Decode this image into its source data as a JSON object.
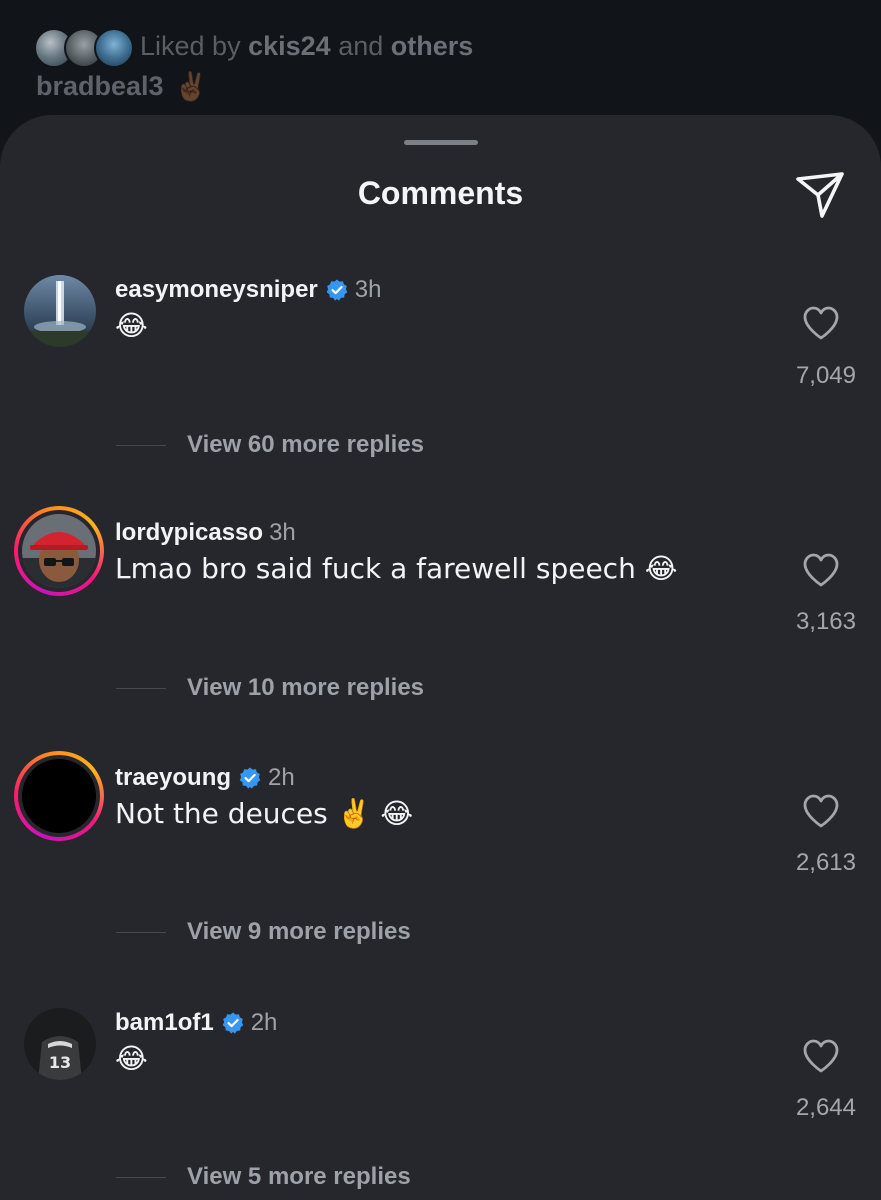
{
  "post": {
    "liked_prefix": "Liked by",
    "liked_user": "ckis24",
    "liked_and": "and",
    "liked_others": "others",
    "caption_user": "bradbeal3",
    "caption_emoji": "✌🏾"
  },
  "sheet": {
    "title": "Comments",
    "share_icon": "send-icon"
  },
  "comments": [
    {
      "username": "easymoneysniper",
      "verified": true,
      "time": "3h",
      "text": "😂",
      "likes": "7,049",
      "replies": "View 60 more replies"
    },
    {
      "username": "lordypicasso",
      "verified": false,
      "time": "3h",
      "text": "Lmao bro said fuck a farewell speech 😂",
      "likes": "3,163",
      "replies": "View 10 more replies"
    },
    {
      "username": "traeyoung",
      "verified": true,
      "time": "2h",
      "text": "Not the deuces ✌️  😂",
      "likes": "2,613",
      "replies": "View 9 more replies"
    },
    {
      "username": "bam1of1",
      "verified": true,
      "time": "2h",
      "text": "😂",
      "likes": "2,644",
      "replies": "View 5 more replies"
    }
  ],
  "colors": {
    "sheet_bg": "#25272c",
    "verified_blue": "#3797f0",
    "story_ring_start": "#c913b9",
    "story_ring_end": "#ffb21f"
  }
}
